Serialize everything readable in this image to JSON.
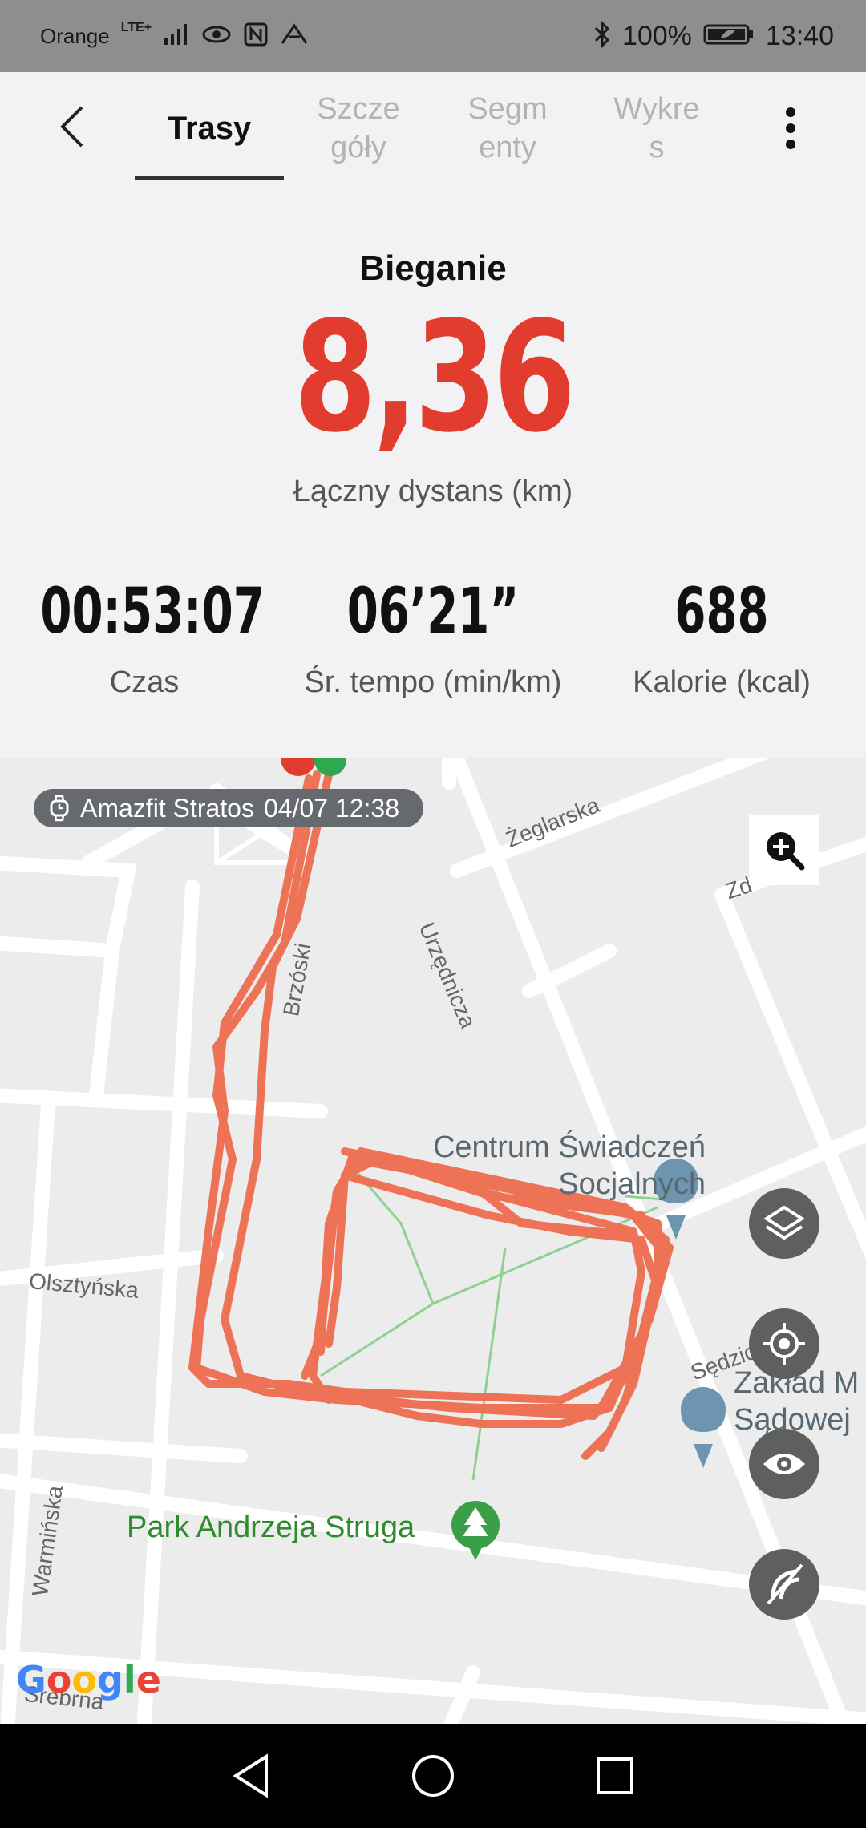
{
  "status_bar": {
    "carrier": "Orange",
    "network": "LTE+",
    "battery": "100%",
    "time": "13:40"
  },
  "tabs": [
    {
      "label": "Trasy"
    },
    {
      "label": "Szcze\ngóły"
    },
    {
      "label": "Segm\nenty"
    },
    {
      "label": "Wykre\ns"
    }
  ],
  "summary": {
    "activity": "Bieganie",
    "distance": "8,36",
    "distance_label": "Łączny dystans (km)",
    "stats": [
      {
        "value": "00:53:07",
        "label": "Czas"
      },
      {
        "value": "06’21”",
        "label": "Śr. tempo (min/km)"
      },
      {
        "value": "688",
        "label": "Kalorie (kcal)"
      }
    ]
  },
  "map": {
    "device": "Amazfit Stratos",
    "date": "04/07 12:38",
    "streets": {
      "zeglarska": "Żeglarska",
      "urzednicza": "Urzędnicza",
      "brzoski": "Brzóski",
      "olsztynska": "Olsztyńska",
      "warminska": "Warmińska",
      "sedziowska": "Sędziowska",
      "srebrna": "Srebrna",
      "zd": "Zd"
    },
    "poi_centrum": "Centrum Świadczeń\nSocjalnych",
    "poi_zaklad": "Zakład M\nSądowej",
    "park": "Park Andrzeja Struga",
    "logo": "Google",
    "route_color": "#ef6c4f"
  },
  "colors": {
    "accent": "#e23c2e",
    "route": "#ef6c4f"
  }
}
